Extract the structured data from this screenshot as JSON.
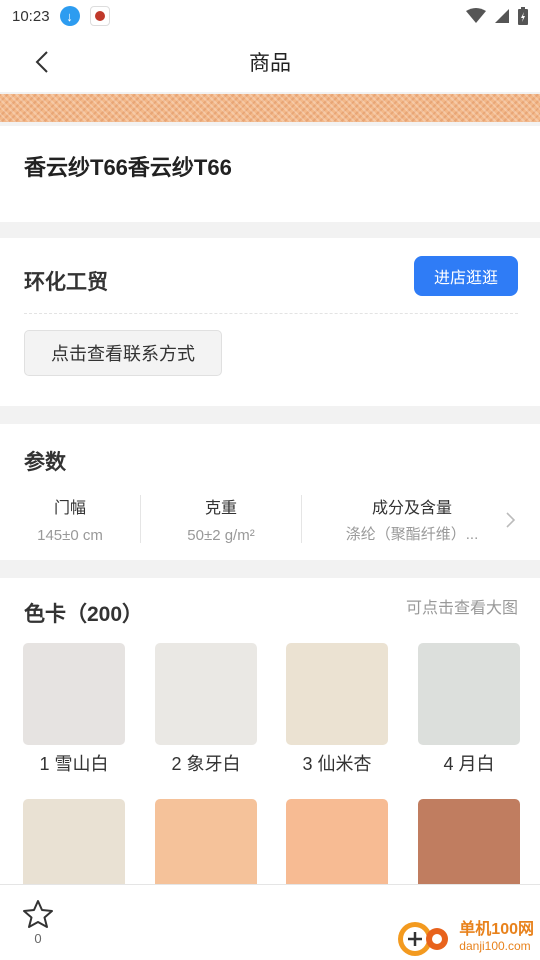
{
  "status_bar": {
    "time": "10:23"
  },
  "header": {
    "title": "商品"
  },
  "product": {
    "name": "香云纱T66香云纱T66"
  },
  "shop": {
    "name": "环化工贸",
    "visit_label": "进店逛逛",
    "contact_label": "点击查看联系方式"
  },
  "params": {
    "title": "参数",
    "items": [
      {
        "name": "门幅",
        "value": "145±0 cm"
      },
      {
        "name": "克重",
        "value": "50±2 g/m²"
      },
      {
        "name": "成分及含量",
        "value": "涤纶（聚酯纤维）..."
      }
    ]
  },
  "color_card": {
    "title": "色卡（200）",
    "hint": "可点击查看大图",
    "swatches": [
      {
        "label": "1 雪山白",
        "color": "#e6e3e1"
      },
      {
        "label": "2 象牙白",
        "color": "#eae8e4"
      },
      {
        "label": "3 仙米杏",
        "color": "#ebe2d2"
      },
      {
        "label": "4 月白",
        "color": "#dcdfdc"
      },
      {
        "label": "",
        "color": "#e9e1d3"
      },
      {
        "label": "",
        "color": "#f5c29a"
      },
      {
        "label": "",
        "color": "#f7bb93"
      },
      {
        "label": "",
        "color": "#c07d60"
      }
    ]
  },
  "bottom_bar": {
    "favorite_count": "0"
  },
  "watermark": {
    "cn": "单机100网",
    "en": "danji100.com"
  }
}
